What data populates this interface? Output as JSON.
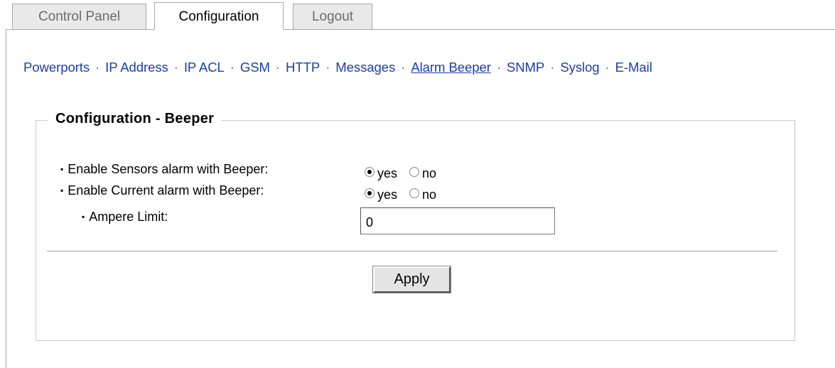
{
  "tabs": [
    {
      "label": "Control Panel",
      "active": false
    },
    {
      "label": "Configuration",
      "active": true
    },
    {
      "label": "Logout",
      "active": false
    }
  ],
  "nav": {
    "items": [
      "Powerports",
      "IP Address",
      "IP ACL",
      "GSM",
      "HTTP",
      "Messages",
      "Alarm Beeper",
      "SNMP",
      "Syslog",
      "E-Mail"
    ],
    "current": "Alarm Beeper",
    "separator": "·"
  },
  "section": {
    "title": "Configuration - Beeper"
  },
  "form": {
    "sensors_alarm": {
      "label": "Enable Sensors alarm with Beeper:",
      "yes_label": "yes",
      "no_label": "no",
      "selected": "yes"
    },
    "current_alarm": {
      "label": "Enable Current alarm with Beeper:",
      "yes_label": "yes",
      "no_label": "no",
      "selected": "yes"
    },
    "ampere_limit": {
      "label": "Ampere Limit:",
      "value": "0"
    },
    "apply_label": "Apply"
  }
}
